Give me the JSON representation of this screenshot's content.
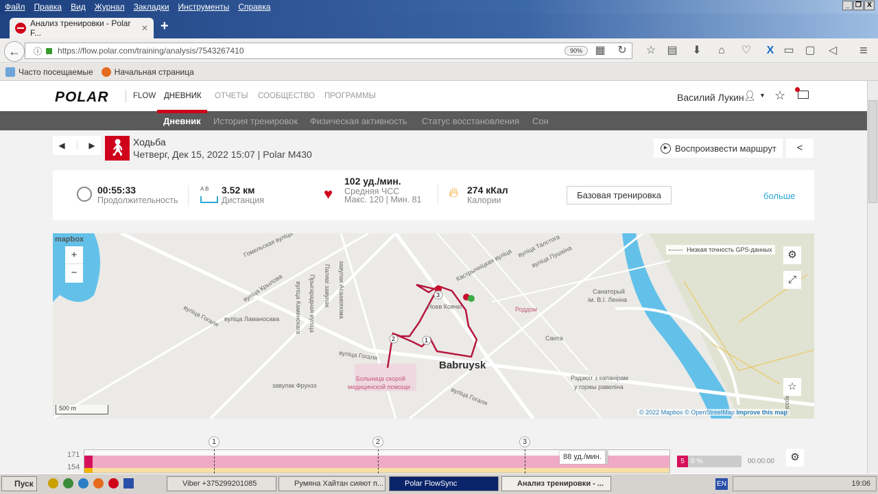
{
  "browser": {
    "menu": [
      "Файл",
      "Правка",
      "Вид",
      "Журнал",
      "Закладки",
      "Инструменты",
      "Справка"
    ],
    "tab_title": "Анализ тренировки - Polar F...",
    "url": "https://flow.polar.com/training/analysis/7543267410",
    "zoom": "90%",
    "bookmarks": [
      "Часто посещаемые",
      "Начальная страница"
    ]
  },
  "header": {
    "logo": "POLAR",
    "flow": "FLOW",
    "nav": [
      "ДНЕВНИК",
      "ОТЧЕТЫ",
      "СООБЩЕСТВО",
      "ПРОГРАММЫ"
    ],
    "user": "Василий Лукин",
    "subnav": [
      "Дневник",
      "История тренировок",
      "Физическая активность",
      "Статус восстановления",
      "Сон"
    ],
    "accent": "#d0021b"
  },
  "training": {
    "sport": "Ходьба",
    "details": "Четверг, Дек 15, 2022 15:07 | Polar M430",
    "replay": "Воспроизвести маршрут",
    "duration": "00:55:33",
    "duration_label": "Продолжительность",
    "distance": "3.52 км",
    "distance_label": "Дистанция",
    "ab": "A   B",
    "hr": "102 уд./мин.",
    "hr_label": "Средняя ЧСС",
    "hr_minmax": "Макс. 120  |  Мин. 81",
    "calories": "274 кКал",
    "calories_label": "Калории",
    "benefit": "Базовая тренировка",
    "more": "больше"
  },
  "map": {
    "brand": "mapbox",
    "legend": "Низкая точность GPS-данных",
    "scale": "500 m",
    "attribution": {
      "copy": "© 2022 Mapbox",
      "osm": "© OpenStreetMap",
      "improve": "Improve this map"
    },
    "labels": [
      "Гомельская вуліца",
      "вуліца Крылова",
      "вуліца Гогаля",
      "вуліца Ламаносава",
      "вуліца Каменскага",
      "Прыгарадная вуліца",
      "Паляві завулак",
      "завулак Асаавіяхіма",
      "вуліца Гогаля",
      "завулак Фрунзэ",
      "Больница скорой",
      "медицинской помощи",
      "Babruysk",
      "Роддом",
      "Санта",
      "Санаторый",
      "ім. В.І. Леніна",
      "Рэдзюіт з капанірам",
      "у горжы равеліна",
      "вуліца Талстога",
      "вуліца Пушкіна",
      "Кастрычніцкая вуліца",
      "Ноев Ковчег",
      "вуліца Гогаля",
      "Бярэзіна"
    ],
    "laps": [
      "1",
      "2",
      "3"
    ]
  },
  "hrchart": {
    "y_ticks": [
      "171",
      "154"
    ],
    "laps": [
      "1",
      "2",
      "3"
    ],
    "tooltip": "88 уд./мин.",
    "zone": "5",
    "zone_pct": "0 %",
    "zone_time": "00:00:00",
    "zone_colors": [
      "#d6115c",
      "#f4a9c6",
      "#f5dd9c"
    ]
  },
  "taskbar": {
    "start": "Пуск",
    "tasks": [
      "Viber +375299201085",
      "Румяна Хайтан сияют п...",
      "Polar FlowSync",
      "Анализ тренировки - ..."
    ],
    "lang": "EN",
    "clock": "19:06"
  }
}
